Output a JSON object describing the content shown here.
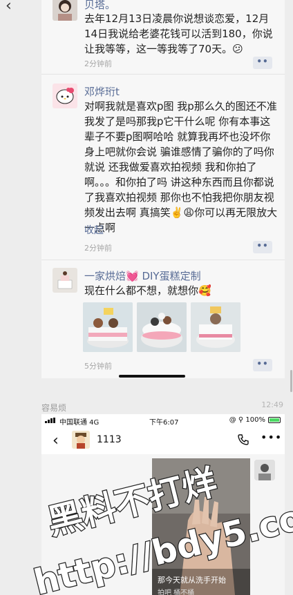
{
  "feed": {
    "first_post": {
      "name_partial": "贝塔。",
      "text": "去年12月13日凌晨你说想谈恋爱，12月14日我说给老婆花钱可以活到180，你说让我等等，这一等我等了70天。😕",
      "time": "2分钟前"
    },
    "second_post": {
      "name": "邓烨珩t",
      "text": "对啊我就是喜欢p图 我p那么久的图还不准我发了是吗那我p它干什么呢 你有本事这辈子不要p图啊哈哈 就算我再坏也没坏你身上吧就你会说 骗谁感情了骗你的了吗你就说 还我做爱喜欢拍视频 我和你拍了啊。。。和你拍了吗 讲这种东西而且你都说了我喜欢拍视频 那你也不怕我把你朋友视频发出去啊 真搞笑✌️😩你可以再无限放大一点啊",
      "collapse_label": "收起",
      "time": "2分钟前"
    },
    "third_post": {
      "name": "一家烘焙💓 DIY蛋糕定制",
      "text": "现在什么都不想，就想你🥰",
      "time": "5分钟前",
      "images": [
        "cake-photo-1",
        "cake-photo-2",
        "cake-photo-3"
      ]
    },
    "more_label": "••"
  },
  "chat": {
    "contact_name": "容易烦",
    "time": "12:49"
  },
  "embedded": {
    "carrier": "中国联通  4G",
    "clock": "下午6:07",
    "battery": "@ ⚲ 100%",
    "title": "1113",
    "video_caption": "那今天就从洗手开始",
    "video_caption_2": "拍吧 桶不桶",
    "dots": "•••"
  },
  "watermark": {
    "line1": "黑料不打烊",
    "line2": "http://bdy5.co"
  },
  "colors": {
    "link": "#576b95",
    "background": "#ededed",
    "card": "#f7f7f7"
  }
}
